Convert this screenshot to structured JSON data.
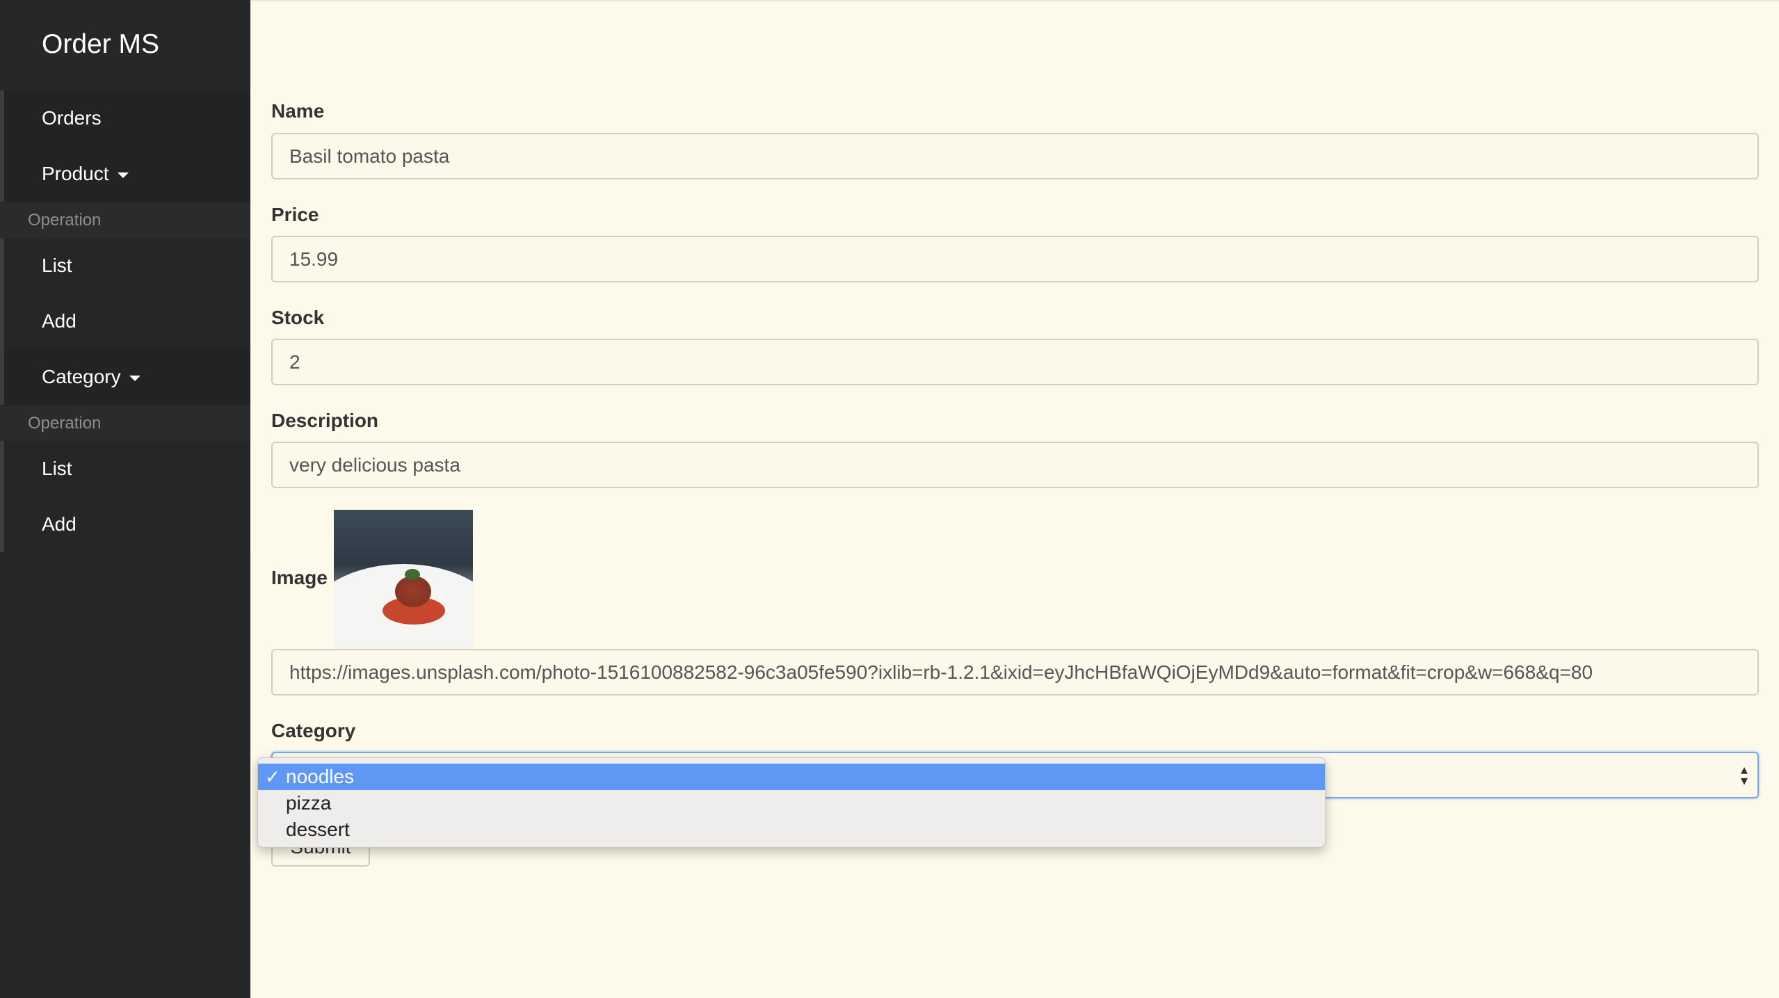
{
  "app": {
    "brand": "Order MS"
  },
  "sidebar": {
    "orders": "Orders",
    "product": {
      "label": "Product",
      "header": "Operation",
      "items": [
        "List",
        "Add"
      ]
    },
    "category": {
      "label": "Category",
      "header": "Operation",
      "items": [
        "List",
        "Add"
      ]
    }
  },
  "form": {
    "name": {
      "label": "Name",
      "value": "Basil tomato pasta"
    },
    "price": {
      "label": "Price",
      "value": "15.99"
    },
    "stock": {
      "label": "Stock",
      "value": "2"
    },
    "description": {
      "label": "Description",
      "value": "very delicious pasta"
    },
    "image": {
      "label": "Image",
      "url": "https://images.unsplash.com/photo-1516100882582-96c3a05fe590?ixlib=rb-1.2.1&ixid=eyJhcHBfaWQiOjEyMDd9&auto=format&fit=crop&w=668&q=80"
    },
    "category": {
      "label": "Category",
      "selected": "noodles",
      "options": [
        "noodles",
        "pizza",
        "dessert"
      ]
    },
    "submit_label": "Submit"
  },
  "colors": {
    "sidebar_bg": "#262728",
    "page_bg": "#fdfaeb",
    "selected_option": "#5f97f4"
  }
}
